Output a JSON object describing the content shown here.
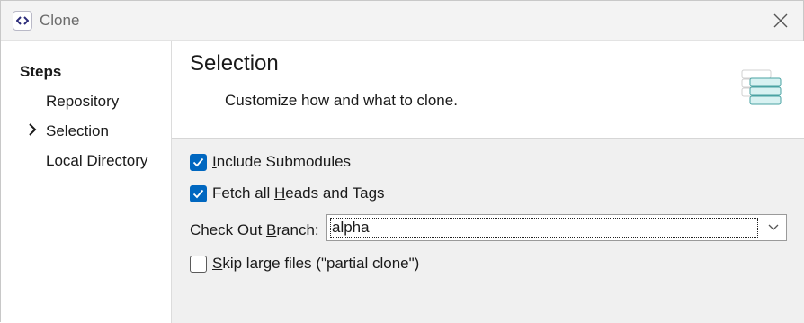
{
  "window": {
    "title": "Clone"
  },
  "sidebar": {
    "heading": "Steps",
    "items": [
      {
        "label": "Repository"
      },
      {
        "label": "Selection",
        "current": true
      },
      {
        "label": "Local Directory"
      }
    ]
  },
  "header": {
    "title": "Selection",
    "description": "Customize how and what to clone."
  },
  "options": {
    "include_submodules": {
      "label_pre": "",
      "mnemonic": "I",
      "label_post": "nclude Submodules",
      "checked": true
    },
    "fetch_heads": {
      "label_pre": "Fetch all ",
      "mnemonic": "H",
      "label_post": "eads and Tags",
      "checked": true
    },
    "checkout_branch": {
      "label_pre": "Check Out ",
      "mnemonic": "B",
      "label_post": "ranch:",
      "value": "alpha"
    },
    "skip_large": {
      "label_pre": "",
      "mnemonic": "S",
      "label_post": "kip large files (\"partial clone\")",
      "checked": false
    }
  },
  "icons": {
    "app": "code-brackets-icon",
    "close": "close-icon",
    "current_step": "chevron-right-icon",
    "header": "database-stack-icon",
    "dropdown": "chevron-down-icon",
    "check": "checkmark-icon"
  },
  "colors": {
    "accent": "#0067c0"
  }
}
